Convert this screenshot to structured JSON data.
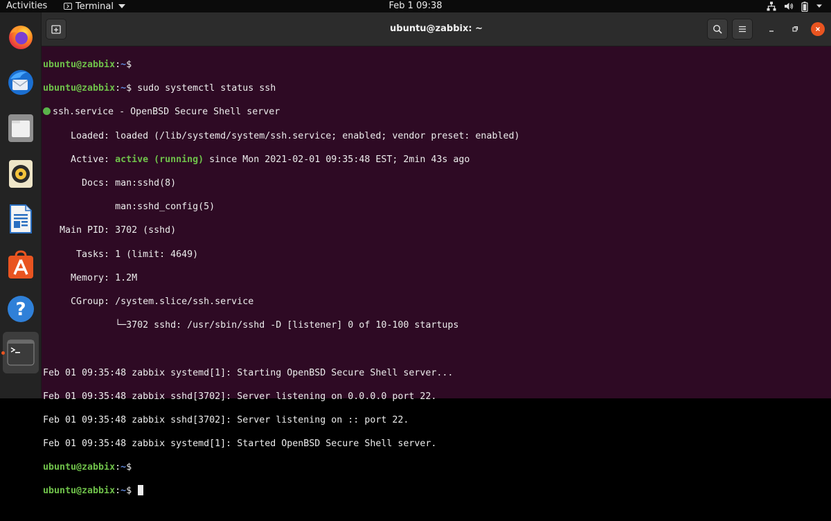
{
  "topbar": {
    "activities": "Activities",
    "app_menu": "Terminal",
    "clock": "Feb 1  09:38",
    "tray_icons": [
      "network-icon",
      "volume-icon",
      "battery-icon",
      "system-menu-chevron-icon"
    ]
  },
  "dock": {
    "items": [
      {
        "name": "firefox",
        "icon": "firefox-icon",
        "running": false
      },
      {
        "name": "thunderbird",
        "icon": "thunderbird-icon",
        "running": false
      },
      {
        "name": "files",
        "icon": "files-icon",
        "running": false
      },
      {
        "name": "rhythmbox",
        "icon": "rhythmbox-icon",
        "running": false
      },
      {
        "name": "libreoffice-writer",
        "icon": "writer-icon",
        "running": false
      },
      {
        "name": "ubuntu-software",
        "icon": "software-icon",
        "running": false
      },
      {
        "name": "help",
        "icon": "help-icon",
        "running": false
      },
      {
        "name": "terminal",
        "icon": "terminal-icon",
        "running": true
      }
    ]
  },
  "window": {
    "title": "ubuntu@zabbix: ~",
    "buttons": [
      "new-tab-icon",
      "search-icon",
      "hamburger-menu-icon",
      "minimize-icon",
      "maximize-icon",
      "close-icon"
    ]
  },
  "terminal": {
    "prompt_user": "ubuntu@zabbix",
    "prompt_sep": ":",
    "prompt_path": "~",
    "prompt_sym": "$ ",
    "command": "sudo systemctl status ssh",
    "service_line": "ssh.service - OpenBSD Secure Shell server",
    "loaded": "     Loaded: loaded (/lib/systemd/system/ssh.service; enabled; vendor preset: enabled)",
    "active_label": "     Active: ",
    "active_state": "active (running)",
    "active_rest": " since Mon 2021-02-01 09:35:48 EST; 2min 43s ago",
    "docs1": "       Docs: man:sshd(8)",
    "docs2": "             man:sshd_config(5)",
    "main_pid": "   Main PID: 3702 (sshd)",
    "tasks": "      Tasks: 1 (limit: 4649)",
    "memory": "     Memory: 1.2M",
    "cgroup": "     CGroup: /system.slice/ssh.service",
    "cgroup_child": "             └─3702 sshd: /usr/sbin/sshd -D [listener] 0 of 10-100 startups",
    "log": [
      "Feb 01 09:35:48 zabbix systemd[1]: Starting OpenBSD Secure Shell server...",
      "Feb 01 09:35:48 zabbix sshd[3702]: Server listening on 0.0.0.0 port 22.",
      "Feb 01 09:35:48 zabbix sshd[3702]: Server listening on :: port 22.",
      "Feb 01 09:35:48 zabbix systemd[1]: Started OpenBSD Secure Shell server."
    ]
  }
}
